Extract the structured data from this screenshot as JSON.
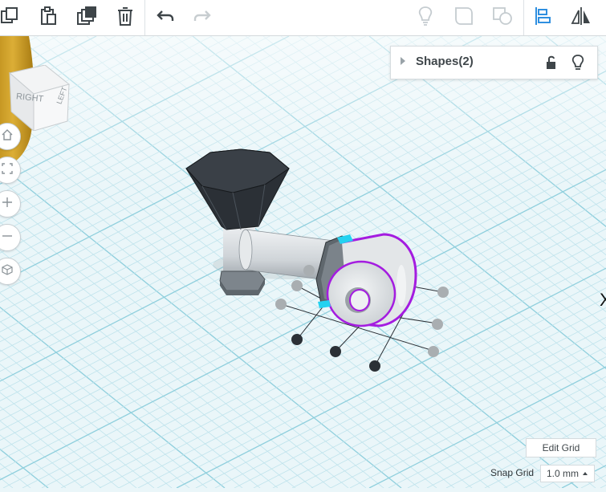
{
  "toolbar": {
    "tools": [
      {
        "name": "copy-icon"
      },
      {
        "name": "paste-icon"
      },
      {
        "name": "duplicate-icon"
      },
      {
        "name": "trash-icon"
      },
      {
        "name": "undo-icon"
      },
      {
        "name": "redo-icon"
      },
      {
        "name": "lightbulb-icon"
      },
      {
        "name": "group-icon"
      },
      {
        "name": "ungroup-icon"
      },
      {
        "name": "align-icon"
      },
      {
        "name": "mirror-icon"
      }
    ]
  },
  "shapes_panel": {
    "title": "Shapes(2)",
    "lock_icon": "unlock-icon",
    "visibility_icon": "lightbulb-icon"
  },
  "view_cube": {
    "face_right": "RIGHT",
    "face_left": "LEFT"
  },
  "view_controls": [
    "home-icon",
    "fit-all-icon",
    "zoom-in-icon",
    "zoom-out-icon",
    "perspective-icon"
  ],
  "grid": {
    "edit_label": "Edit Grid",
    "snap_label": "Snap Grid",
    "snap_value": "1.0 mm"
  },
  "colors": {
    "grid_line": "#bfe3ec",
    "grid_major": "#8fcfdd",
    "funnel": "#2b3036",
    "selection": "#a41ce0",
    "handle": "#24d2f0",
    "yellow_shape": "#d4a72a",
    "accent_blue": "#2f8fe0"
  }
}
